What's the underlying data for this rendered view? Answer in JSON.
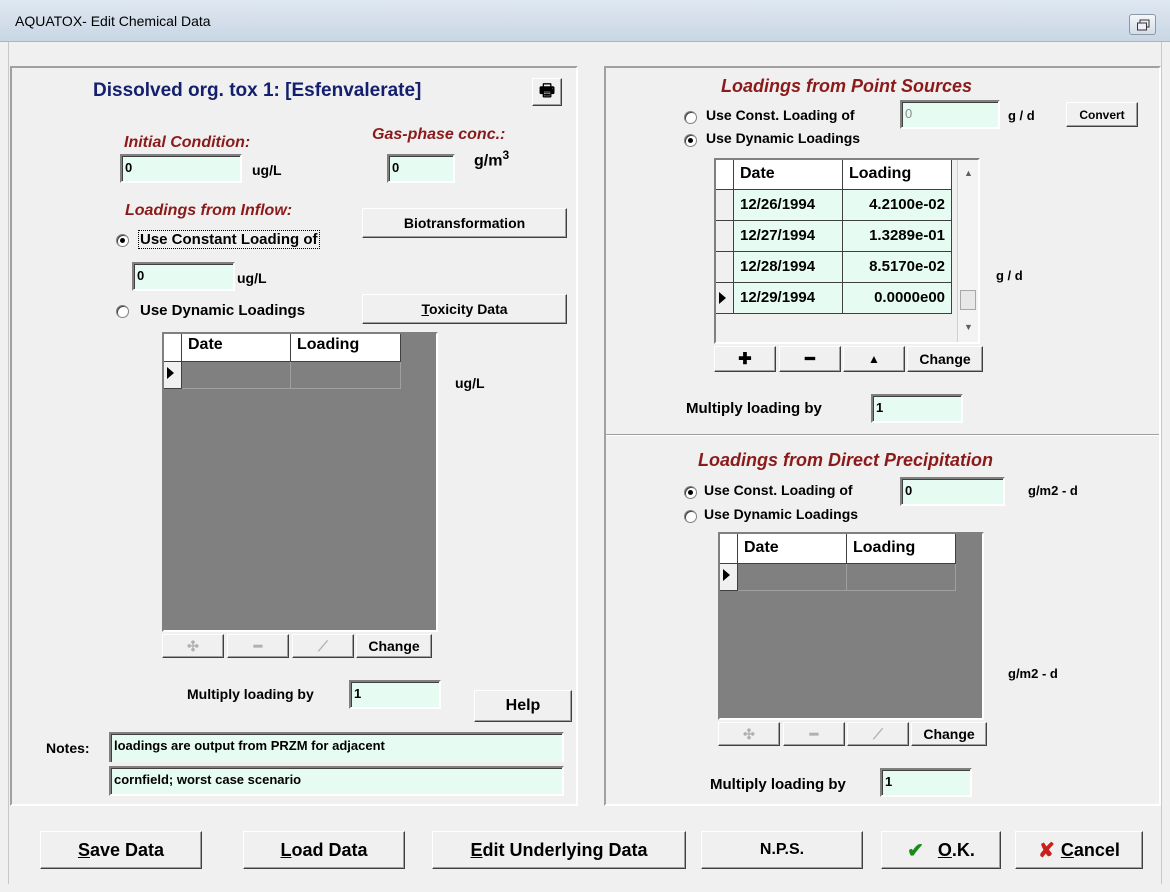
{
  "window": {
    "title": "AQUATOX- Edit Chemical Data"
  },
  "left": {
    "heading": "Dissolved org. tox 1: [Esfenvalerate]",
    "initial_condition": {
      "label": "Initial Condition:",
      "value": "0",
      "unit": "ug/L"
    },
    "gas_phase": {
      "label": "Gas-phase conc.:",
      "value": "0",
      "unit": "g/m",
      "unit_sup": "3"
    },
    "inflow_label": "Loadings from Inflow:",
    "biotransformation_button": "Biotransformation",
    "use_constant_label": "Use Constant Loading of",
    "constant_value": "0",
    "constant_unit": "ug/L",
    "use_dynamic_label": "Use Dynamic Loadings",
    "toxicity_button": "Toxicity Data",
    "grid": {
      "columns": [
        "Date",
        "Loading"
      ],
      "unit": "ug/L"
    },
    "change_button": "Change",
    "multiply_label": "Multiply loading by",
    "multiply_value": "1",
    "help_button": "Help",
    "notes_label": "Notes:",
    "notes_line1": "loadings are output from PRZM for adjacent",
    "notes_line2": "cornfield; worst case scenario"
  },
  "point_sources": {
    "heading": "Loadings from Point Sources",
    "use_const_label": "Use Const. Loading of",
    "const_value": "0",
    "const_unit": "g / d",
    "convert_button": "Convert",
    "use_dynamic_label": "Use Dynamic Loadings",
    "columns": [
      "Date",
      "Loading"
    ],
    "rows": [
      {
        "date": "12/26/1994",
        "loading": "4.2100e-02"
      },
      {
        "date": "12/27/1994",
        "loading": "1.3289e-01"
      },
      {
        "date": "12/28/1994",
        "loading": "8.5170e-02"
      },
      {
        "date": "12/29/1994",
        "loading": "0.0000e00"
      }
    ],
    "unit": "g / d",
    "change_button": "Change",
    "multiply_label": "Multiply loading by",
    "multiply_value": "1"
  },
  "precipitation": {
    "heading": "Loadings from Direct Precipitation",
    "use_const_label": "Use Const. Loading of",
    "const_value": "0",
    "const_unit": "g/m2 - d",
    "use_dynamic_label": "Use Dynamic Loadings",
    "columns": [
      "Date",
      "Loading"
    ],
    "unit": "g/m2 - d",
    "change_button": "Change",
    "multiply_label": "Multiply loading by",
    "multiply_value": "1"
  },
  "bottom": {
    "save_prefix": "S",
    "save_rest": "ave Data",
    "load_prefix": "L",
    "load_rest": "oad Data",
    "edit_prefix": "E",
    "edit_rest": "dit Underlying Data",
    "nps": "N.P.S.",
    "ok_prefix": "O",
    "ok_rest": ".K.",
    "cancel_prefix": "C",
    "cancel_rest": "ancel"
  },
  "colors": {
    "field_bg": "#e6fbf2",
    "heading_red": "#8b1a1a",
    "heading_navy": "#14206e",
    "ok_green": "#1a8a1a",
    "cancel_red": "#c8201a"
  }
}
